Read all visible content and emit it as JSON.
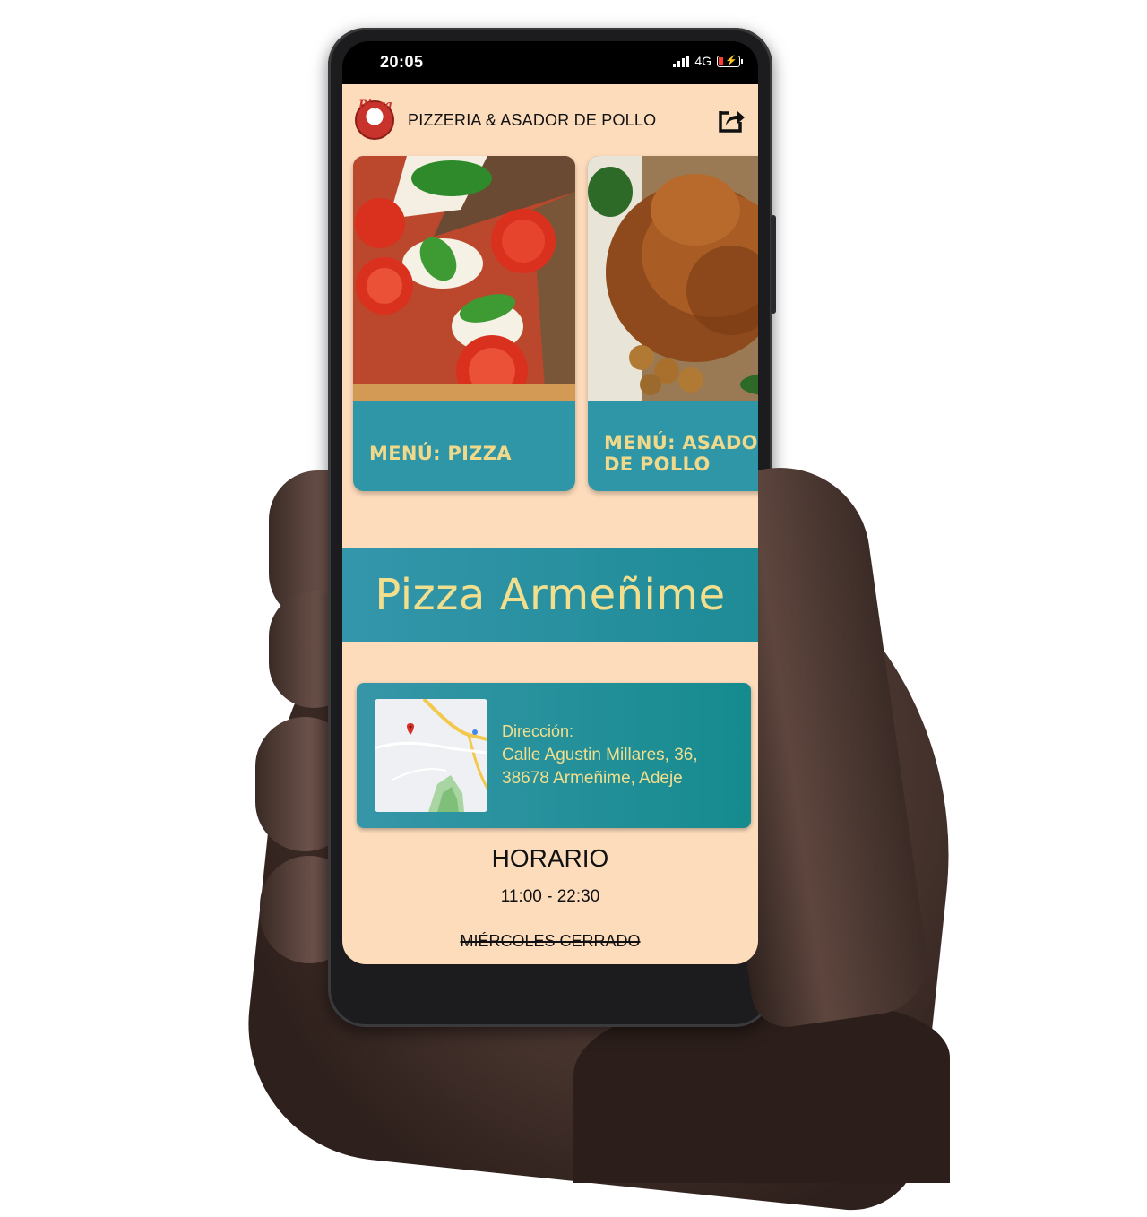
{
  "status_bar": {
    "time": "20:05",
    "network": "4G"
  },
  "app_bar": {
    "logo_text": "Pizza",
    "title": "PIZZERIA & ASADOR DE POLLO",
    "share_icon": "share-icon"
  },
  "menu_cards": [
    {
      "label": "MENÚ: PIZZA",
      "image": "pizza-photo"
    },
    {
      "label": "MENÚ: ASADOR\nDE POLLO",
      "image": "roast-chicken-photo"
    }
  ],
  "banner": {
    "title": "Pizza Armeñime"
  },
  "address": {
    "label": "Dirección:",
    "line1": "Calle Agustin Millares, 36,",
    "line2": "38678 Armeñime, Adeje",
    "map_icon": "map-thumbnail"
  },
  "schedule": {
    "title": "HORARIO",
    "hours": "11:00 - 22:30",
    "closed": "MIÉRCOLES CERRADO"
  },
  "colors": {
    "background": "#fddcbc",
    "teal": "#2e96a6",
    "gold_text": "#f2df8e"
  }
}
